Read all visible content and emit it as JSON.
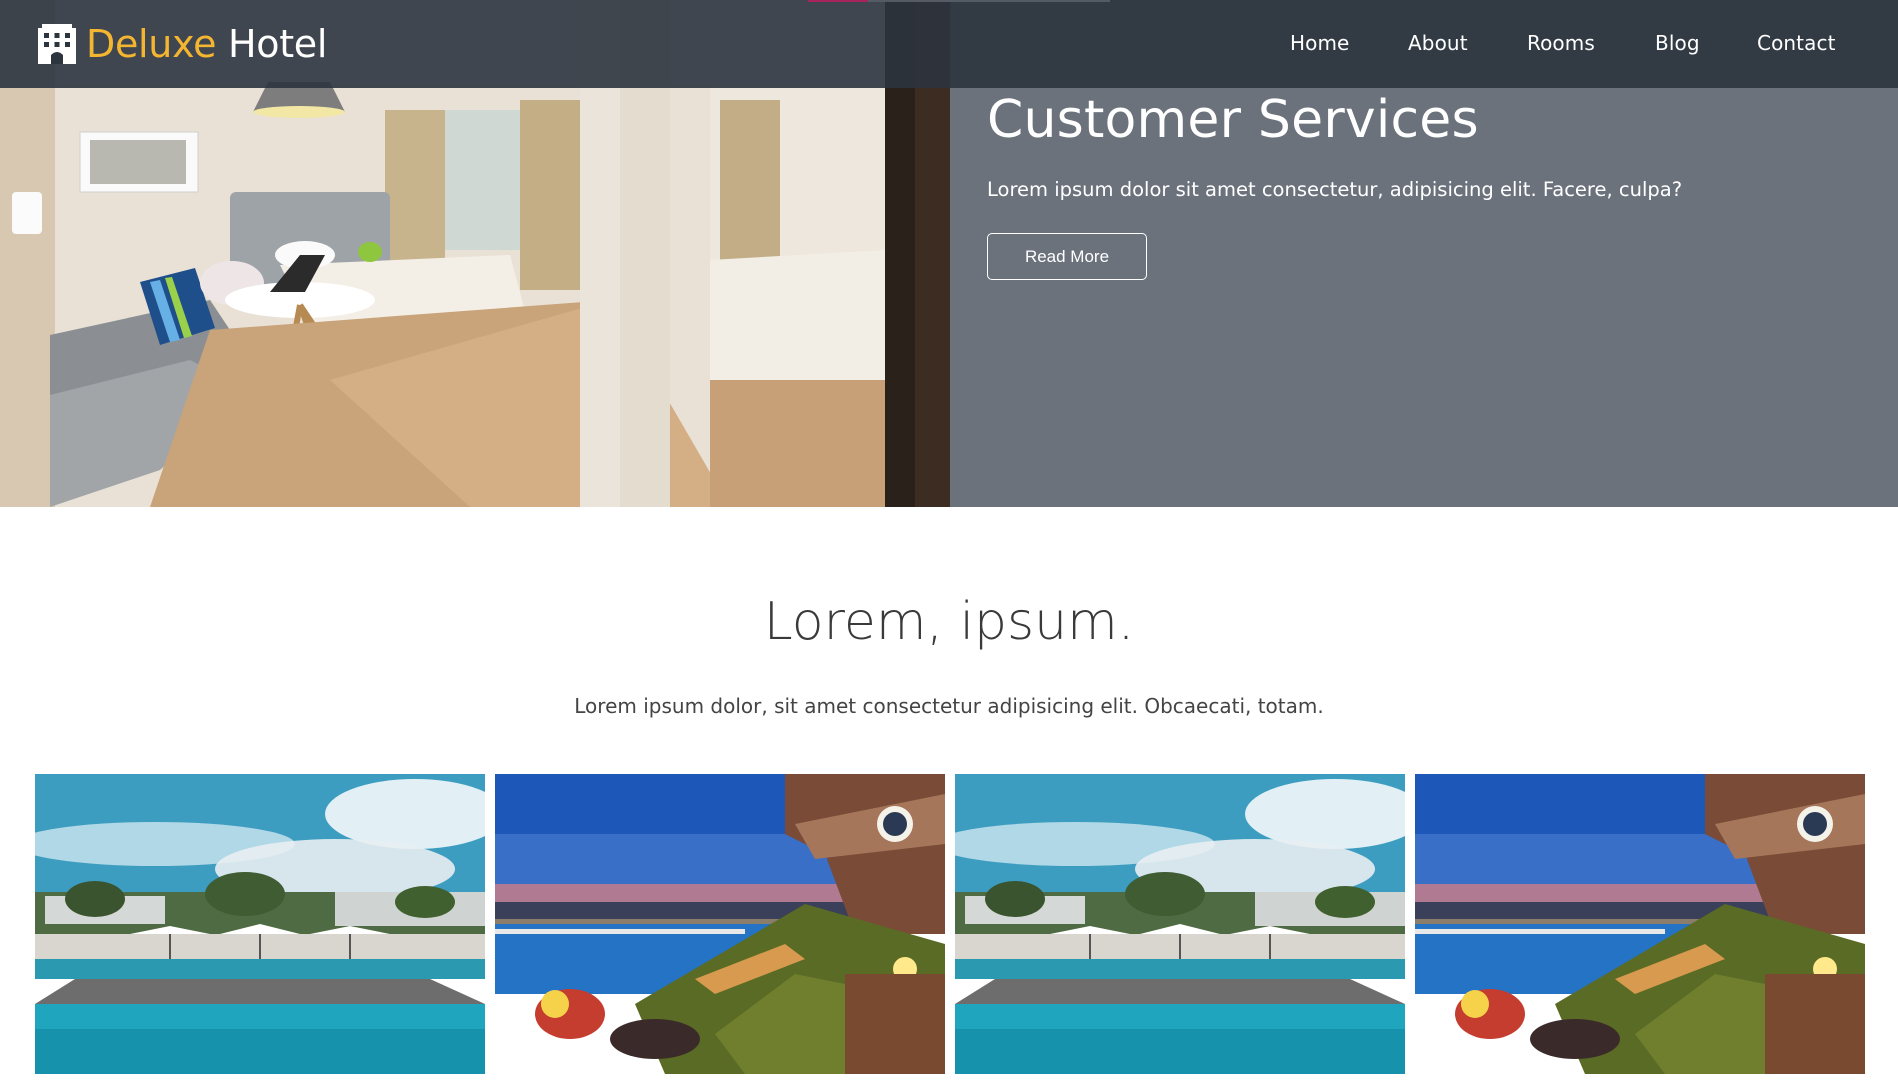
{
  "brand": {
    "name_accent": "Deluxe",
    "name_plain": "Hotel",
    "icon": "hotel-building-icon",
    "accent_color": "#f4b630"
  },
  "nav": {
    "items": [
      {
        "label": "Home"
      },
      {
        "label": "About"
      },
      {
        "label": "Rooms"
      },
      {
        "label": "Blog"
      },
      {
        "label": "Contact"
      }
    ]
  },
  "hero": {
    "title": "Customer Services",
    "text": "Lorem ipsum dolor sit amet consectetur, adipisicing elit. Facere, culpa?",
    "button_label": "Read More",
    "panel_color": "#6b727c"
  },
  "section": {
    "title": "Lorem, ipsum.",
    "text": "Lorem ipsum dolor, sit amet consectetur adipisicing elit. Obcaecati, totam."
  },
  "gallery": {
    "items": [
      {
        "scene": "day-pool"
      },
      {
        "scene": "night-terrace-pool"
      },
      {
        "scene": "day-pool"
      },
      {
        "scene": "night-terrace-pool"
      }
    ]
  }
}
